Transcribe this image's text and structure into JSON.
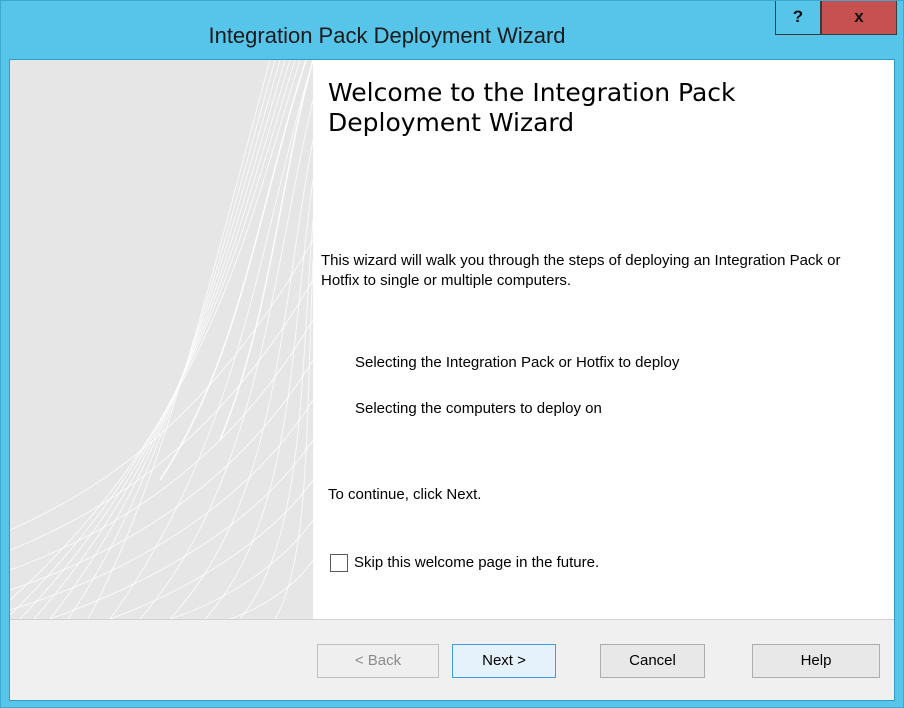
{
  "window": {
    "title": "Integration Pack Deployment Wizard",
    "help_glyph": "?",
    "close_glyph": "x",
    "accent_color": "#57c4ea",
    "close_color": "#c75050"
  },
  "welcome": {
    "title": "Welcome to the Integration Pack Deployment Wizard",
    "intro": "This wizard will walk you through the steps of deploying an Integration Pack or Hotfix to single or multiple computers.",
    "steps": [
      "Selecting the Integration Pack or Hotfix to deploy",
      "Selecting the computers to deploy on"
    ],
    "continue_text": "To continue, click Next.",
    "skip_checkbox": {
      "label": "Skip this welcome page in the future.",
      "checked": false
    }
  },
  "buttons": {
    "back": "< Back",
    "next": "Next >",
    "cancel": "Cancel",
    "help": "Help"
  }
}
